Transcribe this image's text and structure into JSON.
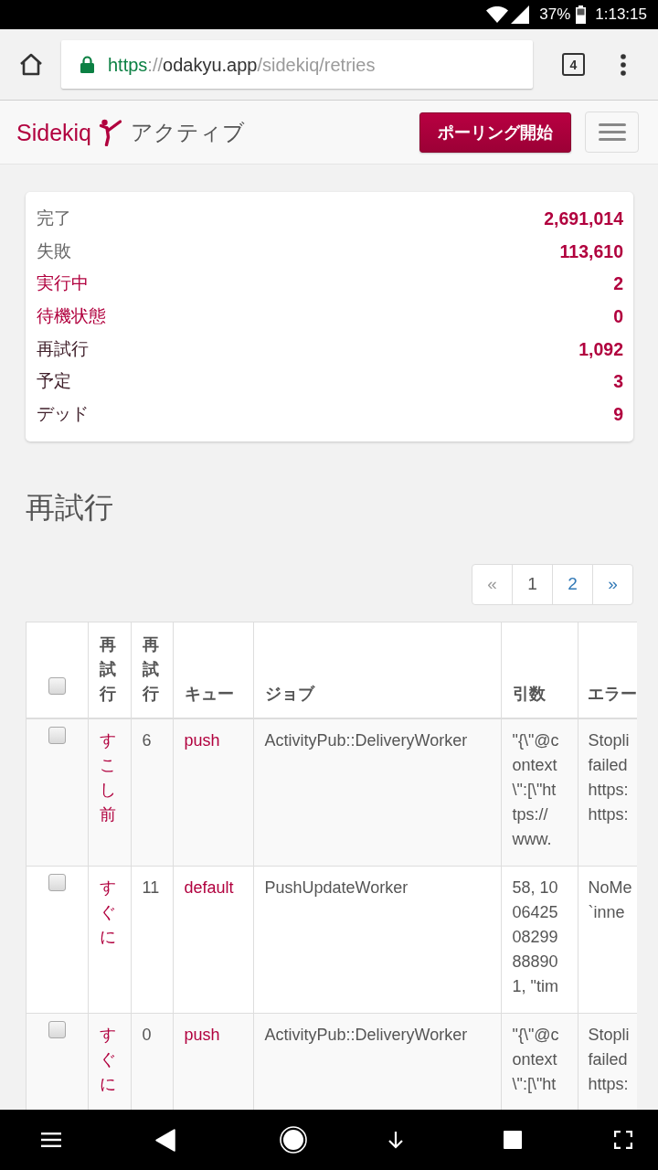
{
  "status_bar": {
    "battery": "37%",
    "time": "1:13:15"
  },
  "browser": {
    "url": {
      "scheme": "https",
      "separator": "://",
      "host": "odakyu.app",
      "path": "/sidekiq/retries"
    },
    "tab_count": "4"
  },
  "navbar": {
    "brand": "Sidekiq",
    "status": "アクティブ",
    "poll_button": "ポーリング開始"
  },
  "summary": [
    {
      "label": "完了",
      "value": "2,691,014",
      "kind": "plain"
    },
    {
      "label": "失敗",
      "value": "113,610",
      "kind": "plain"
    },
    {
      "label": "実行中",
      "value": "2",
      "kind": "link"
    },
    {
      "label": "待機状態",
      "value": "0",
      "kind": "link"
    },
    {
      "label": "再試行",
      "value": "1,092",
      "kind": "visited"
    },
    {
      "label": "予定",
      "value": "3",
      "kind": "visited"
    },
    {
      "label": "デッド",
      "value": "9",
      "kind": "visited"
    }
  ],
  "heading": "再試行",
  "pagination": [
    {
      "label": "«",
      "selected": false,
      "disabled": true
    },
    {
      "label": "1",
      "selected": true,
      "disabled": false
    },
    {
      "label": "2",
      "selected": false,
      "disabled": false
    },
    {
      "label": "»",
      "selected": false,
      "disabled": false
    }
  ],
  "table": {
    "select_all": {
      "checked": false
    },
    "columns": [
      "再試行",
      "再試行",
      "キュー",
      "ジョブ",
      "引数",
      "エラー"
    ],
    "rows": [
      {
        "checked": false,
        "time": "すこし前",
        "count": "6",
        "queue": "push",
        "job": "ActivityPub::DeliveryWorker",
        "arguments": "\"{\\\"@c\nontext\n\\\":[\\\"ht\ntps://\nwww.",
        "error": "Stopli\nfailed\nhttps:\nhttps:"
      },
      {
        "checked": false,
        "time": "すぐに",
        "count": "11",
        "queue": "default",
        "job": "PushUpdateWorker",
        "arguments": "58, 10\n06425\n08299\n88890\n1, \"tim",
        "error": "NoMe\n`inne"
      },
      {
        "checked": false,
        "time": "すぐに",
        "count": "0",
        "queue": "push",
        "job": "ActivityPub::DeliveryWorker",
        "arguments": "\"{\\\"@c\nontext\n\\\":[\\\"ht",
        "error": "Stopli\nfailed\nhttps:"
      }
    ]
  }
}
